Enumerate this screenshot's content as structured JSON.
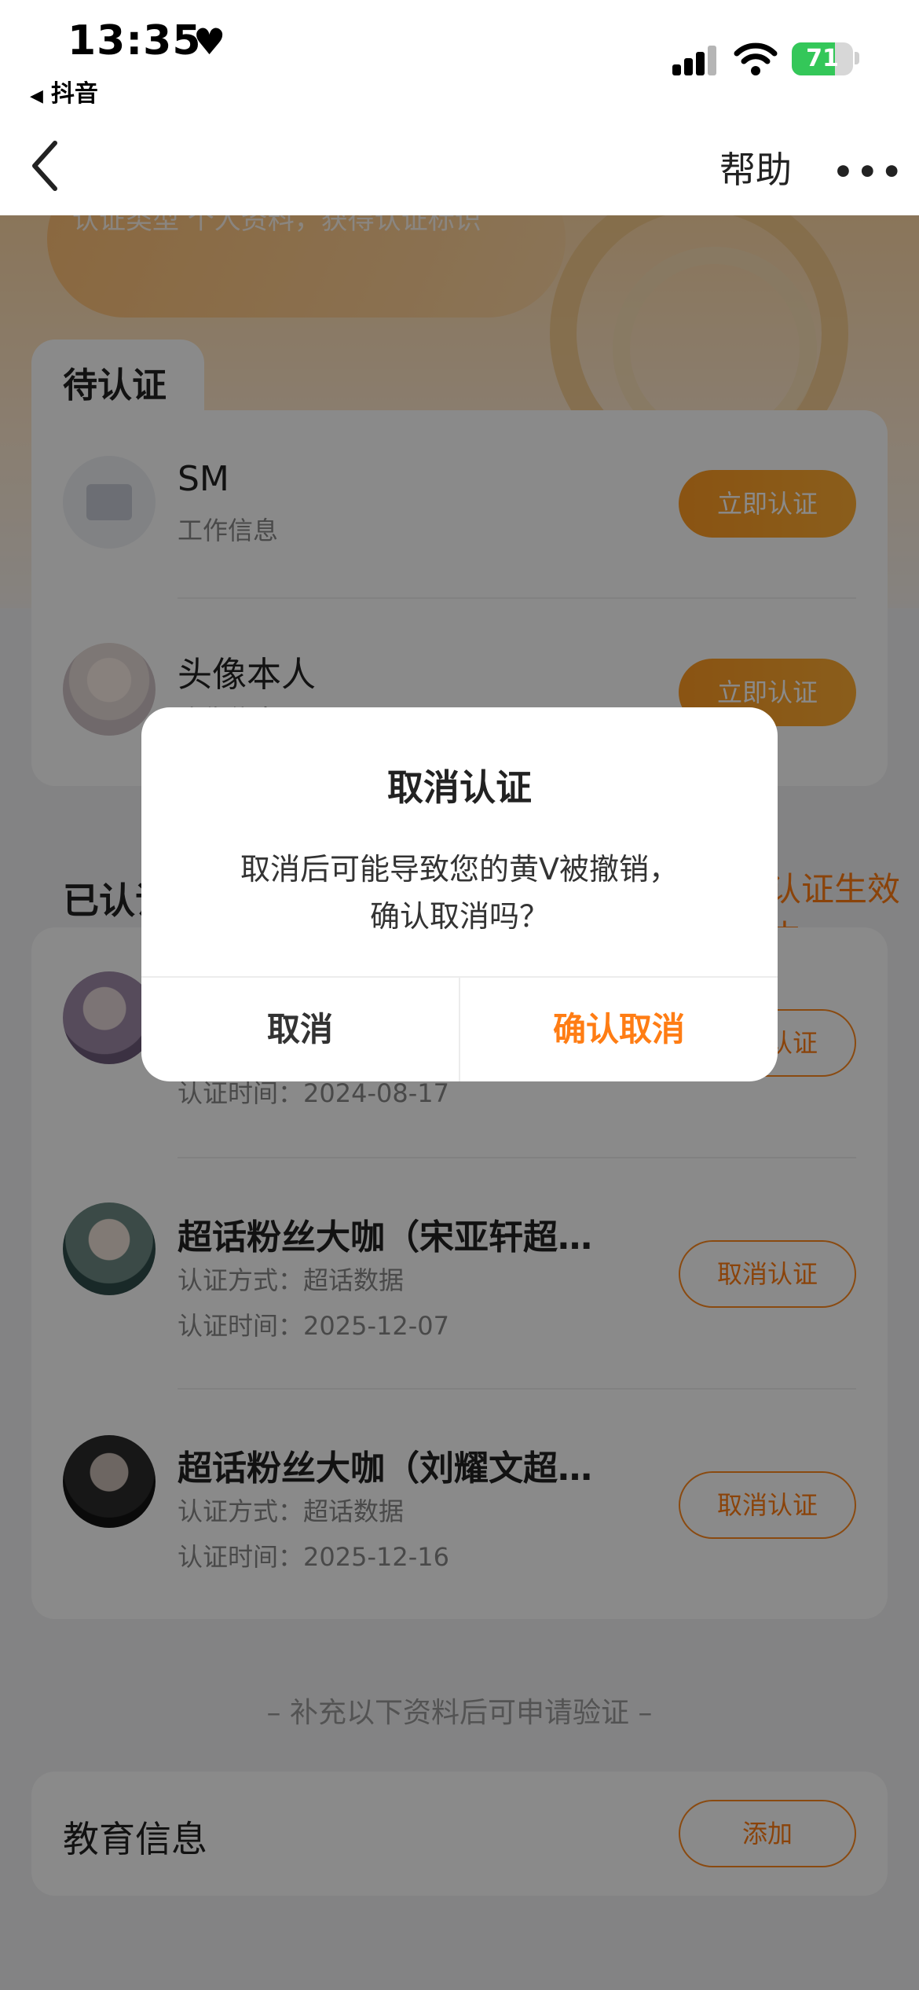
{
  "status_bar": {
    "time": "13:35",
    "heart_glyph": "♥",
    "back_app_glyph": "◀",
    "back_app": "抖音",
    "battery_level": 71,
    "battery_label": "71"
  },
  "nav": {
    "back_icon": "chevron-left-icon",
    "help_label": "帮助",
    "more_glyph": "•••"
  },
  "banner": {
    "text": "认证类型 个人资料，获得认证标识"
  },
  "pending": {
    "tab_label": "待认证",
    "items": [
      {
        "title": "SM",
        "subtitle": "工作信息",
        "button": "立即认证"
      },
      {
        "title": "头像本人",
        "subtitle": "头像信息",
        "button": "立即认证"
      }
    ]
  },
  "verified": {
    "header": "已认证",
    "status": "认证生效中",
    "items": [
      {
        "title": "",
        "method": "",
        "time": "认证时间：2024-08-17",
        "button": "取消认证"
      },
      {
        "title": "超话粉丝大咖（宋亚轩超…",
        "method": "认证方式：超话数据",
        "time": "认证时间：2025-12-07",
        "button": "取消认证"
      },
      {
        "title": "超话粉丝大咖（刘耀文超…",
        "method": "认证方式：超话数据",
        "time": "认证时间：2025-12-16",
        "button": "取消认证"
      }
    ]
  },
  "supplement_hint": "– 补充以下资料后可申请验证 –",
  "education": {
    "label": "教育信息",
    "button": "添加"
  },
  "dialog": {
    "title": "取消认证",
    "message_line1": "取消后可能导致您的黄V被撤销，",
    "message_line2": "确认取消吗？",
    "cancel": "取消",
    "confirm": "确认取消"
  },
  "colors": {
    "accent": "#ff7d14",
    "button_gradient": [
      "#ff9b23",
      "#ffad33"
    ],
    "battery": "#34c759"
  }
}
